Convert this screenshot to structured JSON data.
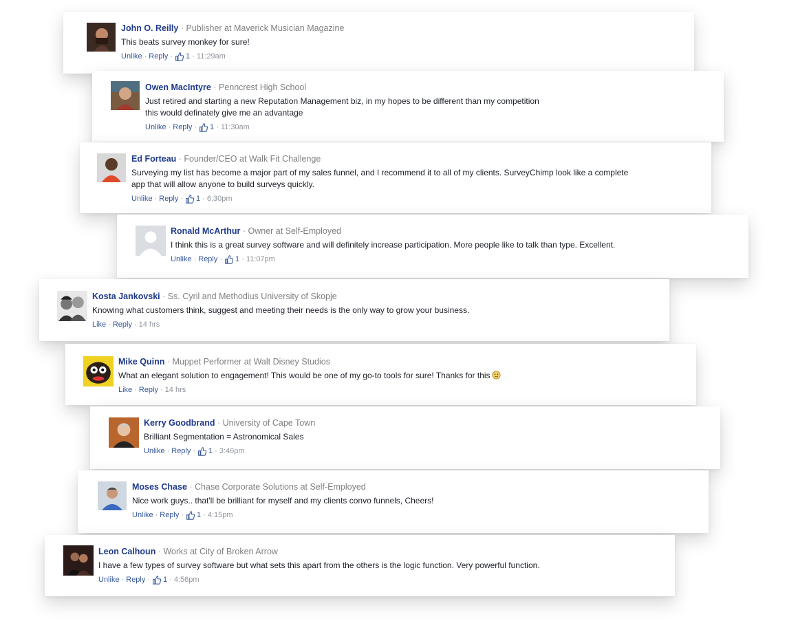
{
  "comments": [
    {
      "name": "John O. Reilly",
      "org": "Publisher at Maverick Musician Magazine",
      "lines": [
        "This beats survey monkey for sure!"
      ],
      "action": "Unlike",
      "reply": "Reply",
      "likes": "1",
      "time": "11:29am"
    },
    {
      "name": "Owen MacIntyre",
      "org": "Penncrest High School",
      "lines": [
        "Just retired and starting a new Reputation Management biz, in my hopes to be different than my competition",
        "this would definately give me an advantage"
      ],
      "action": "Unlike",
      "reply": "Reply",
      "likes": "1",
      "time": "11:30am"
    },
    {
      "name": "Ed Forteau",
      "org": "Founder/CEO at Walk Fit Challenge",
      "lines": [
        "Surveying my list has become a major part of my sales funnel, and I recommend it to all of my clients. SurveyChimp look like a complete",
        "app that will allow anyone to build surveys quickly."
      ],
      "action": "Unlike",
      "reply": "Reply",
      "likes": "1",
      "time": "6:30pm"
    },
    {
      "name": "Ronald McArthur",
      "org": "Owner at Self-Employed",
      "lines": [
        "I think this is a great survey software and will definitely increase participation. More people like to talk than type. Excellent."
      ],
      "action": "Unlike",
      "reply": "Reply",
      "likes": "1",
      "time": "11:07pm"
    },
    {
      "name": "Kosta Jankovski",
      "org": "Ss. Cyril and Methodius University of Skopje",
      "lines": [
        "Knowing what customers think, suggest and meeting their needs is the only way to grow your business."
      ],
      "action": "Like",
      "reply": "Reply",
      "likes": "",
      "time": "14 hrs"
    },
    {
      "name": "Mike Quinn",
      "org": "Muppet Performer at Walt Disney Studios",
      "lines": [
        "What an elegant solution to engagement! This would be one of my go-to tools for sure! Thanks for this"
      ],
      "action": "Like",
      "reply": "Reply",
      "likes": "",
      "time": "14 hrs"
    },
    {
      "name": "Kerry Goodbrand",
      "org": "University of Cape Town",
      "lines": [
        "Brilliant Segmentation = Astronomical Sales"
      ],
      "action": "Unlike",
      "reply": "Reply",
      "likes": "1",
      "time": "3:46pm"
    },
    {
      "name": "Moses Chase",
      "org": "Chase Corporate Solutions at Self-Employed",
      "lines": [
        "Nice work guys.. that'll be brilliant for myself and my clients convo funnels, Cheers!"
      ],
      "action": "Unlike",
      "reply": "Reply",
      "likes": "1",
      "time": "4:15pm"
    },
    {
      "name": "Leon Calhoun",
      "org": "Works at City of Broken Arrow",
      "lines": [
        "I have a few types of survey software but what sets this apart from the others is the logic function. Very powerful function."
      ],
      "action": "Unlike",
      "reply": "Reply",
      "likes": "1",
      "time": "4:56pm"
    }
  ]
}
